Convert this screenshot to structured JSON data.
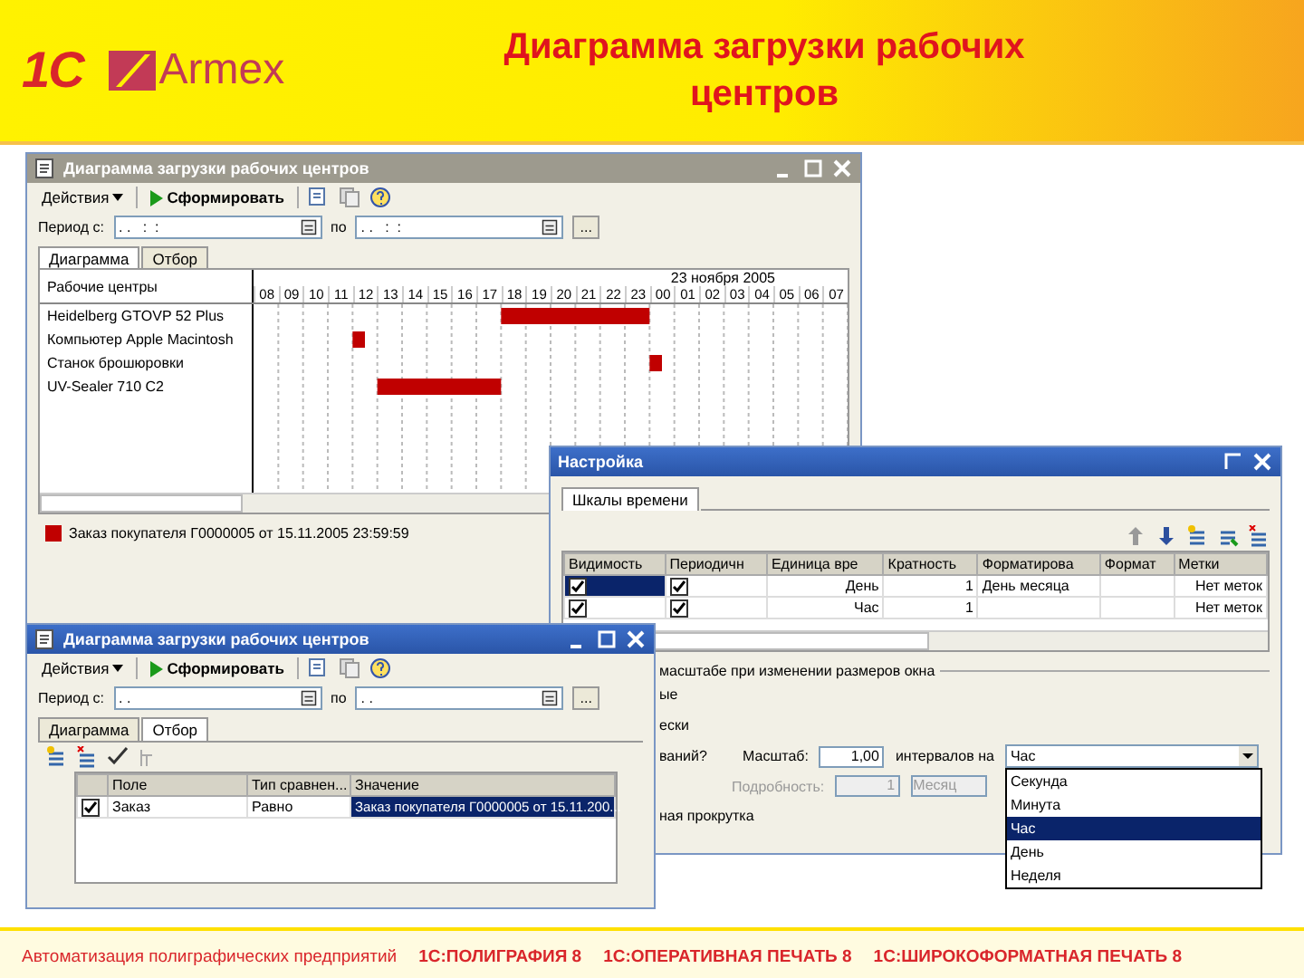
{
  "slide": {
    "logo_1c": "1С",
    "logo_armex": "Armex",
    "title": "Диаграмма загрузки рабочих центров",
    "footer": [
      "Автоматизация полиграфических предприятий",
      "1С:ПОЛИГРАФИЯ 8",
      "1С:ОПЕРАТИВНАЯ ПЕЧАТЬ 8",
      "1С:ШИРОКОФОРМАТНАЯ ПЕЧАТЬ 8"
    ]
  },
  "report_window": {
    "title": "Диаграмма загрузки рабочих центров",
    "active": false,
    "toolbar": {
      "actions": "Действия",
      "run": "Сформировать"
    },
    "period": {
      "label": "Период с:",
      "from": ". .   :  :",
      "to_label": "по",
      "to": ". .   :  :",
      "more": "..."
    },
    "tabs": [
      {
        "label": "Диаграмма",
        "selected": true
      },
      {
        "label": "Отбор",
        "selected": false
      }
    ],
    "gantt": {
      "row_header": "Рабочие центры",
      "date": "23 ноября 2005",
      "hours": [
        "08",
        "09",
        "10",
        "11",
        "12",
        "13",
        "14",
        "15",
        "16",
        "17",
        "18",
        "19",
        "20",
        "21",
        "22",
        "23",
        "00",
        "01",
        "02",
        "03",
        "04",
        "05",
        "06",
        "07"
      ],
      "rows": [
        "Heidelberg GTOVP 52 Plus",
        "Компьютер Apple Macintosh",
        "Станок брошюровки",
        "UV-Sealer 710 C2"
      ]
    },
    "legend": "Заказ покупателя Г0000005 от 15.11.2005 23:59:59"
  },
  "settings_window": {
    "title": "Настройка",
    "active": true,
    "tab": "Шкалы времени",
    "columns": [
      "Видимость",
      "Периодичн",
      "Единица вре",
      "Кратность",
      "Форматирова",
      "Формат",
      "Метки"
    ],
    "rows": [
      {
        "visible": true,
        "periodic": true,
        "unit": "День",
        "multiple": "1",
        "format_string": "День месяца",
        "marks": "Нет меток",
        "selected": true
      },
      {
        "visible": true,
        "periodic": true,
        "unit": "Час",
        "multiple": "1",
        "marks": "Нет меток",
        "selected": false
      }
    ],
    "group_title": "масштабе при изменении размеров окна",
    "fragments": [
      "ые",
      "ески"
    ],
    "scale_row": {
      "label_fragment": "ваний?",
      "scale_label": "Масштаб:",
      "scale": "1,00",
      "per_label": "интервалов на",
      "unit": "Час"
    },
    "detail_row": {
      "label": "Подробность:",
      "value": "1",
      "unit": "Месяц",
      "disabled": true
    },
    "scroll_fragment": "ная прокрутка",
    "unit_options": [
      {
        "label": "Секунда",
        "selected": false
      },
      {
        "label": "Минута",
        "selected": false
      },
      {
        "label": "Час",
        "selected": true
      },
      {
        "label": "День",
        "selected": false
      },
      {
        "label": "Неделя",
        "selected": false
      }
    ]
  },
  "filter_window": {
    "title": "Диаграмма загрузки рабочих центров",
    "active": true,
    "toolbar": {
      "actions": "Действия",
      "run": "Сформировать"
    },
    "period": {
      "label": "Период с:",
      "from": ". .  ",
      "to_label": "по",
      "to": ". .  ",
      "more": "..."
    },
    "tabs": [
      {
        "label": "Диаграмма",
        "selected": false
      },
      {
        "label": "Отбор",
        "selected": true
      }
    ],
    "columns": [
      "Поле",
      "Тип сравнен...",
      "Значение"
    ],
    "rows": [
      {
        "use": true,
        "field": "Заказ",
        "comparison": "Равно",
        "value": "Заказ покупателя Г0000005 от 15.11.200...",
        "selected": true
      }
    ]
  }
}
